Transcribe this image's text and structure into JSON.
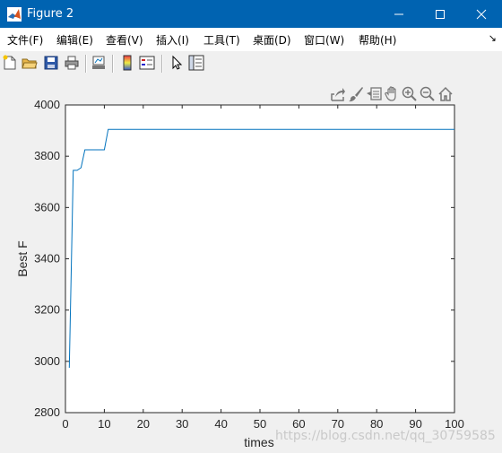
{
  "window": {
    "title": "Figure 2",
    "icon": "matlab-icon",
    "controls": [
      "minimize-icon",
      "maximize-icon",
      "close-icon"
    ]
  },
  "menu": {
    "items": [
      "文件(F)",
      "编辑(E)",
      "查看(V)",
      "插入(I)",
      "工具(T)",
      "桌面(D)",
      "窗口(W)",
      "帮助(H)"
    ],
    "overflow": "↘"
  },
  "toolbar": {
    "icons": [
      "new-figure-icon",
      "open-file-icon",
      "save-icon",
      "print-icon",
      "link-plot-icon",
      "insert-colorbar-icon",
      "insert-legend-icon",
      "edit-plot-icon",
      "property-inspector-icon"
    ]
  },
  "axes_toolbar": {
    "icons": [
      "export-icon",
      "brush-icon",
      "data-tips-icon",
      "pan-icon",
      "zoom-in-icon",
      "zoom-out-icon",
      "home-icon"
    ]
  },
  "chart_data": {
    "type": "line",
    "title": "",
    "xlabel": "times",
    "ylabel": "Best F",
    "xlim": [
      0,
      100
    ],
    "ylim": [
      2800,
      4000
    ],
    "xticks": [
      0,
      10,
      20,
      30,
      40,
      50,
      60,
      70,
      80,
      90,
      100
    ],
    "yticks": [
      2800,
      3000,
      3200,
      3400,
      3600,
      3800,
      4000
    ],
    "grid": false,
    "color": "#0072bd",
    "series": [
      {
        "x": [
          1,
          2,
          3,
          4,
          5,
          6,
          7,
          8,
          9,
          10,
          11,
          12,
          100
        ],
        "y": [
          2975,
          3745,
          3745,
          3755,
          3825,
          3825,
          3825,
          3825,
          3825,
          3825,
          3905,
          3905,
          3905
        ]
      }
    ]
  },
  "watermark": "https://blog.csdn.net/qq_30759585"
}
